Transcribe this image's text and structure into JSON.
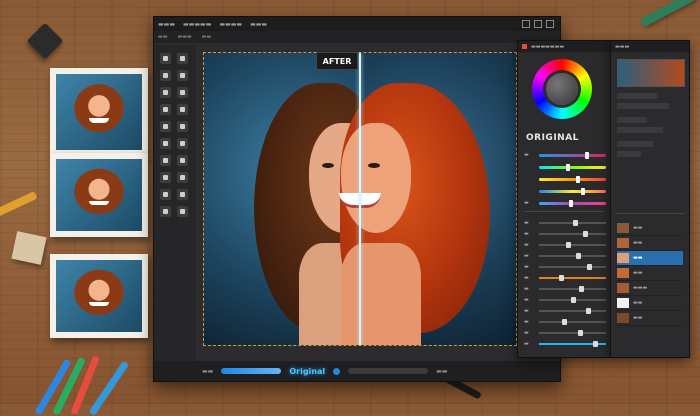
{
  "canvas": {
    "after_label": "AFTER",
    "status_label": "Original"
  },
  "panel": {
    "original_label": "ORIGINAL"
  },
  "colors": {
    "accent_blue": "#2a6fb0",
    "divider_glow": "#d9f3ff",
    "status_text": "#4fc3f7"
  },
  "icons": [
    "move-tool-icon",
    "crop-tool-icon",
    "brush-tool-icon",
    "eraser-tool-icon",
    "clone-stamp-icon",
    "eyedropper-icon",
    "text-tool-icon",
    "zoom-tool-icon",
    "hand-tool-icon",
    "color-swatch-icon"
  ]
}
